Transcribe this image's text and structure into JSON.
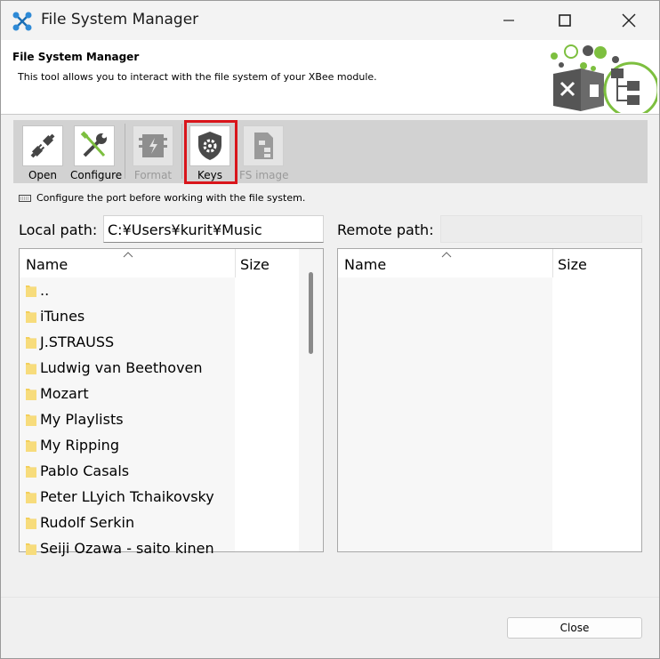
{
  "window": {
    "title": "File System Manager"
  },
  "header": {
    "title": "File System Manager",
    "description": "This tool allows you to interact with the file system of your XBee module."
  },
  "toolbar": {
    "open_label": "Open",
    "configure_label": "Configure",
    "format_label": "Format",
    "keys_label": "Keys",
    "fs_image_label": "FS image"
  },
  "hint": "Configure the port before working with the file system.",
  "local": {
    "label": "Local path:",
    "path": "C:¥Users¥kurit¥Music",
    "columns": {
      "name": "Name",
      "size": "Size"
    },
    "rows": [
      "..",
      "iTunes",
      "J.STRAUSS",
      "Ludwig van Beethoven",
      "Mozart",
      "My Playlists",
      "My Ripping",
      "Pablo Casals",
      "Peter LLyich Tchaikovsky",
      "Rudolf Serkin",
      "Seiji Ozawa - saito kinen"
    ]
  },
  "remote": {
    "label": "Remote path:",
    "path": "",
    "columns": {
      "name": "Name",
      "size": "Size"
    }
  },
  "footer": {
    "close_label": "Close"
  },
  "colors": {
    "accent_green": "#7dbf3f",
    "highlight_red": "#d9151b"
  }
}
